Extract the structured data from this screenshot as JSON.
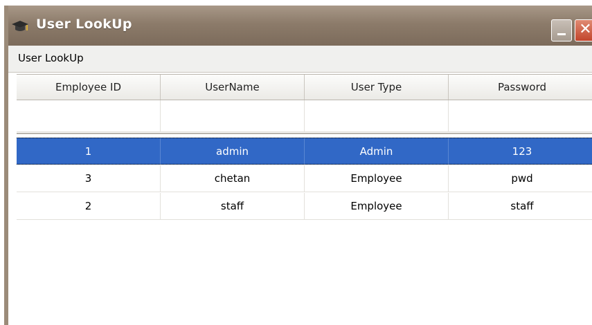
{
  "window": {
    "title": "User LookUp",
    "accent": "#3168c6",
    "close_glyph": "✕"
  },
  "menubar": {
    "label": "User LookUp"
  },
  "grid": {
    "columns": [
      "Employee ID",
      "UserName",
      "User Type",
      "Password"
    ],
    "new_row": [
      "",
      "",
      "",
      ""
    ],
    "rows": [
      [
        "1",
        "admin",
        "Admin",
        "123"
      ],
      [
        "3",
        "chetan",
        "Employee",
        "pwd"
      ],
      [
        "2",
        "staff",
        "Employee",
        "staff"
      ]
    ],
    "selected_row": 0
  }
}
